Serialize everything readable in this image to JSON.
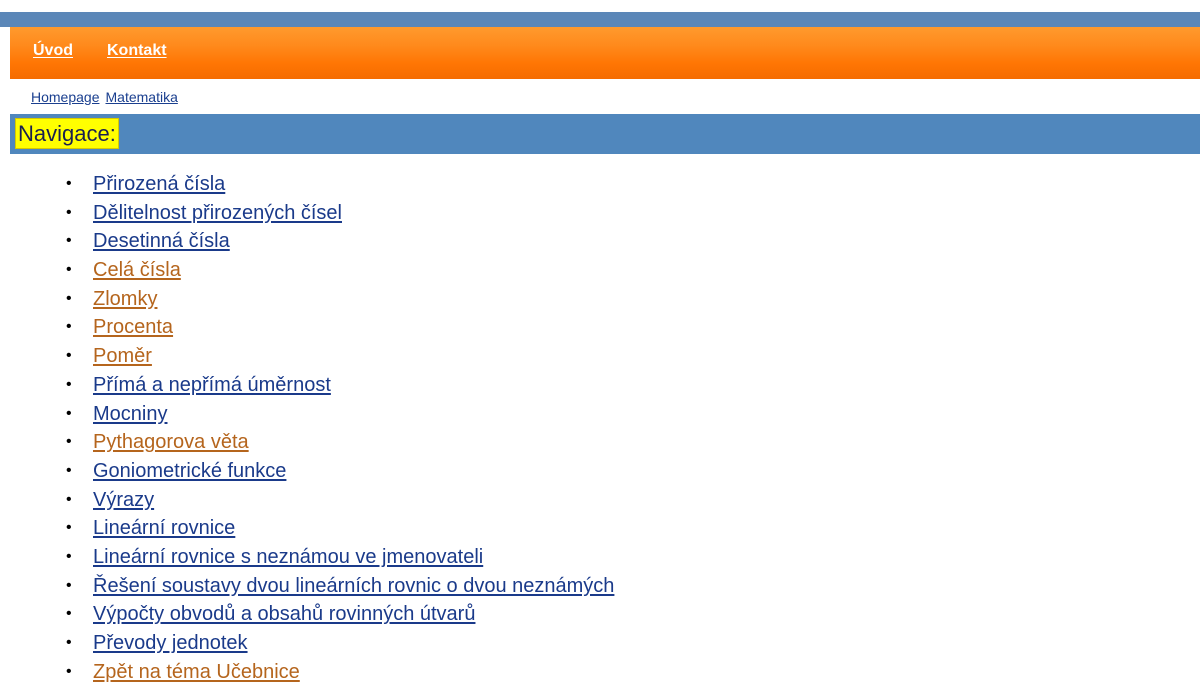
{
  "top_nav": {
    "items": [
      {
        "label": "Úvod"
      },
      {
        "label": "Kontakt"
      }
    ]
  },
  "breadcrumb": {
    "items": [
      {
        "label": "Homepage"
      },
      {
        "label": "Matematika"
      }
    ]
  },
  "section": {
    "title": "Navigace:"
  },
  "nav_list": {
    "bullet": "•",
    "items": [
      {
        "label": "Přirozená čísla",
        "visited": false
      },
      {
        "label": "Dělitelnost přirozených čísel",
        "visited": false
      },
      {
        "label": "Desetinná čísla",
        "visited": false
      },
      {
        "label": "Celá čísla",
        "visited": true
      },
      {
        "label": "Zlomky",
        "visited": true
      },
      {
        "label": "Procenta",
        "visited": true
      },
      {
        "label": "Poměr",
        "visited": true
      },
      {
        "label": "Přímá a nepřímá úměrnost",
        "visited": false
      },
      {
        "label": "Mocniny",
        "visited": false
      },
      {
        "label": "Pythagorova věta",
        "visited": true
      },
      {
        "label": "Goniometrické funkce",
        "visited": false
      },
      {
        "label": "Výrazy",
        "visited": false
      },
      {
        "label": "Lineární rovnice",
        "visited": false
      },
      {
        "label": "Lineární rovnice s neznámou ve jmenovateli",
        "visited": false
      },
      {
        "label": "Řešení soustavy dvou lineárních rovnic o dvou neznámých",
        "visited": false
      },
      {
        "label": "Výpočty obvodů a obsahů rovinných útvarů",
        "visited": false
      },
      {
        "label": "Převody jednotek",
        "visited": false
      },
      {
        "label": "Zpět na téma Učebnice",
        "visited": true
      }
    ]
  },
  "colors": {
    "top_strip": "#5b87b8",
    "nav_bar": "#ff7f0f",
    "section_bar": "#5087bd",
    "section_title_bg": "#ffff00",
    "link": "#1a3a8a",
    "link_visited": "#b5651d"
  }
}
